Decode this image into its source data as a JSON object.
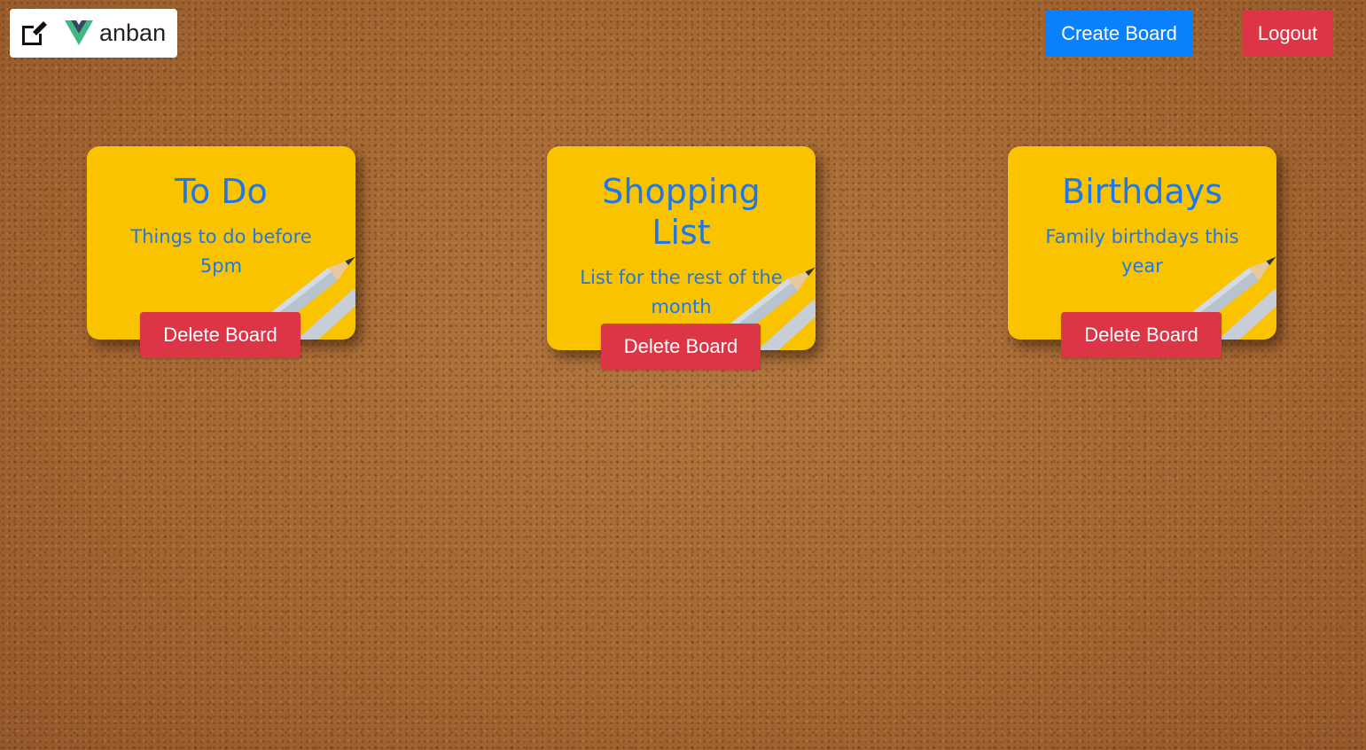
{
  "brand": {
    "text": "anban",
    "edit_icon": "pencil-square-icon",
    "logo_icon": "vue-logo-icon",
    "vue_colors": [
      "#41b883",
      "#35495e"
    ]
  },
  "header": {
    "create_label": "Create Board",
    "logout_label": "Logout"
  },
  "colors": {
    "primary": "#0a80fb",
    "danger": "#dc3545",
    "note": "#fac300",
    "note_text": "#1f78e6"
  },
  "boards": [
    {
      "title": "To Do",
      "description": "Things to do before 5pm",
      "delete_label": "Delete Board"
    },
    {
      "title": "Shopping List",
      "description": "List for the rest of the month",
      "delete_label": "Delete Board"
    },
    {
      "title": "Birthdays",
      "description": "Family birthdays this year",
      "delete_label": "Delete Board"
    }
  ]
}
